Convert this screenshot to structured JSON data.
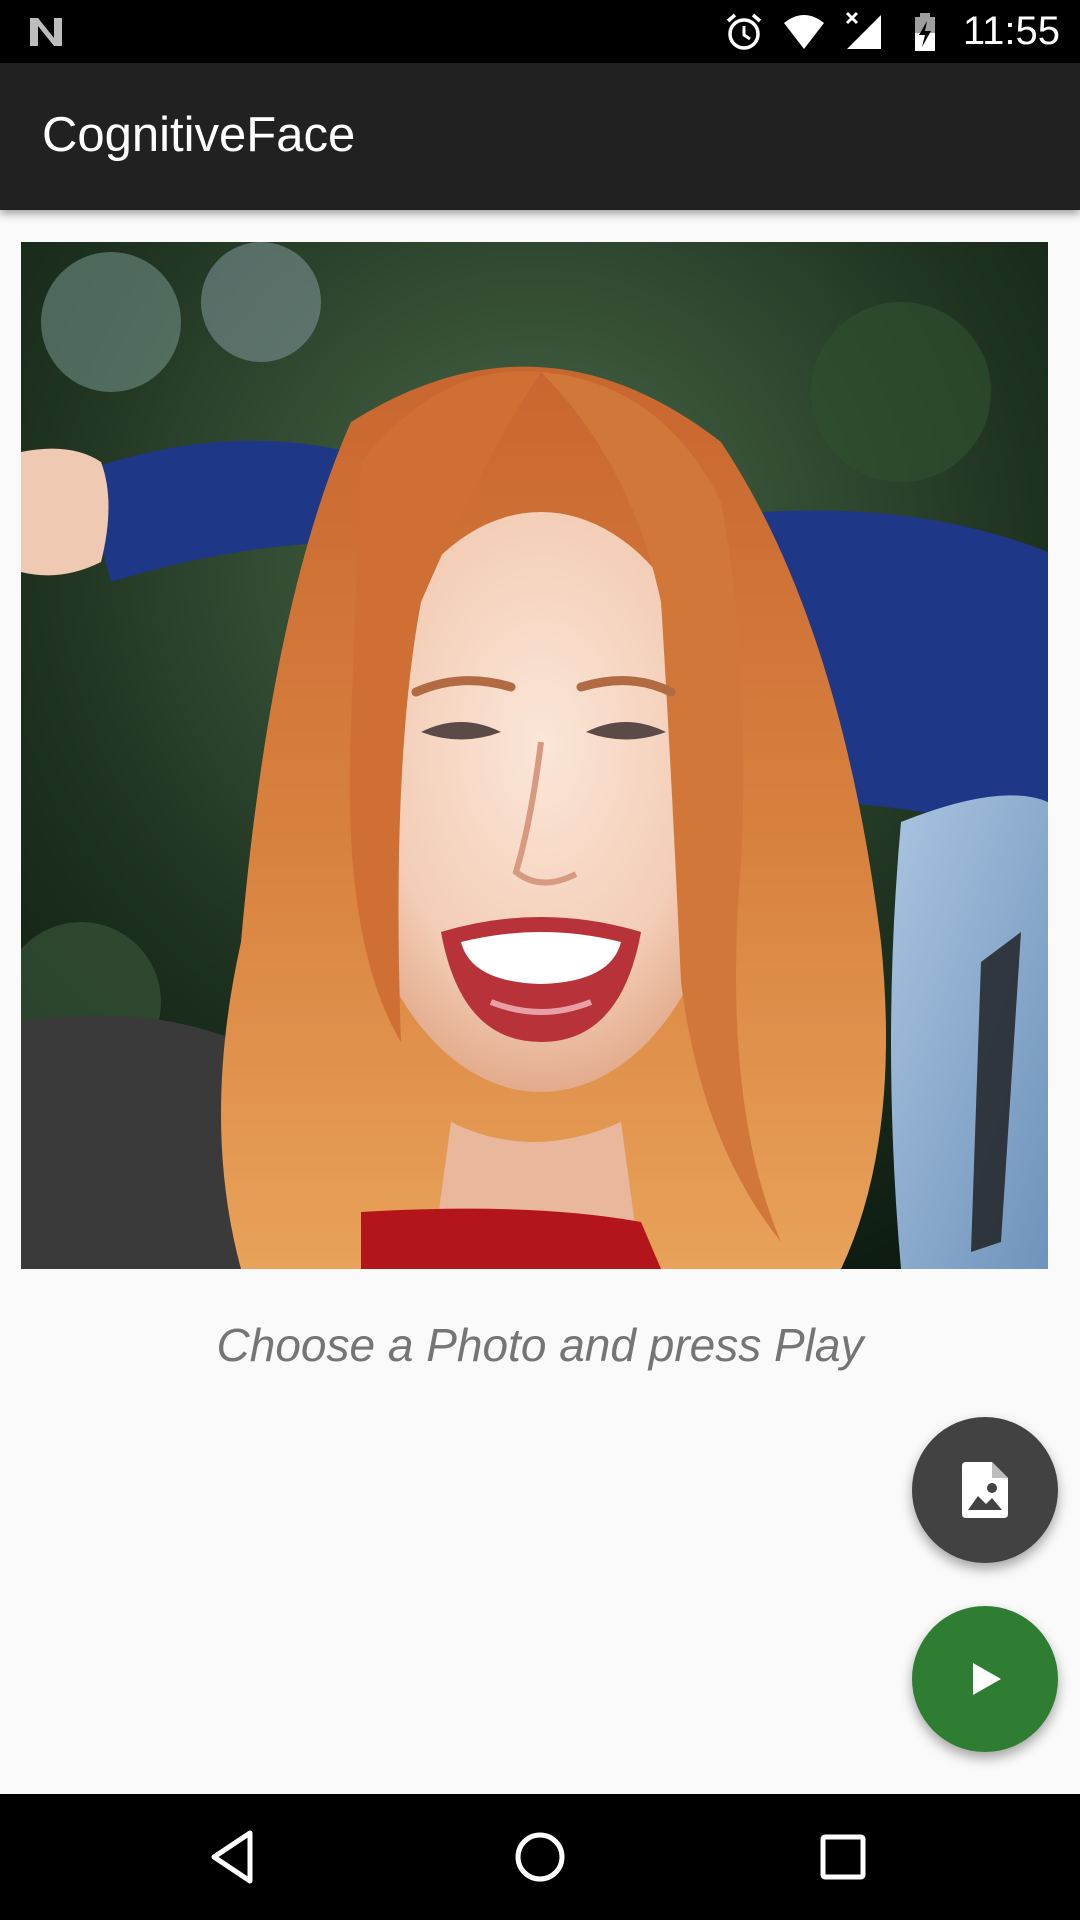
{
  "status_bar": {
    "time": "11:55",
    "icons": [
      "n-logo-icon",
      "alarm-icon",
      "wifi-icon",
      "signal-no-data-icon",
      "battery-charging-icon"
    ]
  },
  "app_bar": {
    "title": "CognitiveFace"
  },
  "main": {
    "photo_alt": "Selected photo of a smiling woman with red hair",
    "hint": "Choose a Photo and press Play"
  },
  "fabs": {
    "choose_photo_icon": "image-file-icon",
    "play_icon": "play-icon"
  },
  "nav_bar": {
    "icons": [
      "back-icon",
      "home-icon",
      "recents-icon"
    ]
  },
  "colors": {
    "status_bar": "#000000",
    "app_bar": "#212121",
    "background": "#fafafa",
    "hint_text": "#757575",
    "fab_photo": "#424242",
    "fab_play": "#2e7d32"
  }
}
